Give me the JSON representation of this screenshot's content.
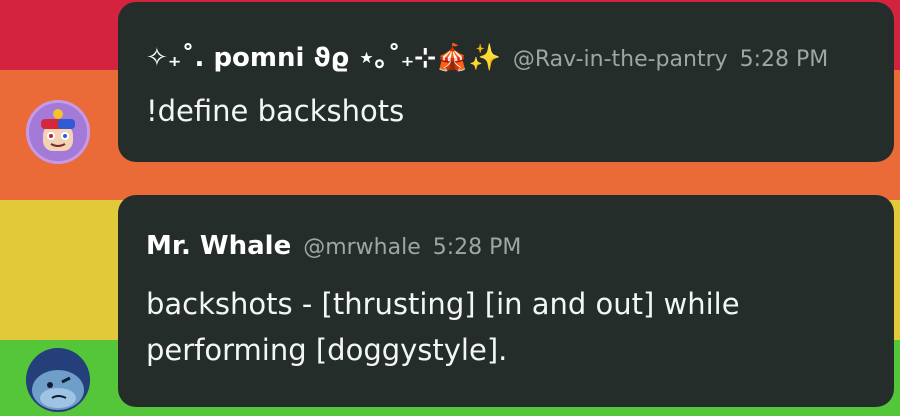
{
  "messages": [
    {
      "display_name": "✧₊˚. pomni ϑϱ ⋆｡˚₊⊹🎪✨",
      "handle": "@Rav-in-the-pantry",
      "time": "5:28 PM",
      "text": "!define backshots"
    },
    {
      "display_name": "Mr. Whale",
      "handle": "@mrwhale",
      "time": "5:28 PM",
      "text": "backshots - [thrusting] [in and out] while performing [doggystyle]."
    }
  ],
  "colors": {
    "bubble": "#252d2a",
    "red_stripe": "#d4233f",
    "orange_stripe": "#ea6a38",
    "yellow_stripe": "#e2c93a",
    "green_stripe": "#55c53a"
  }
}
